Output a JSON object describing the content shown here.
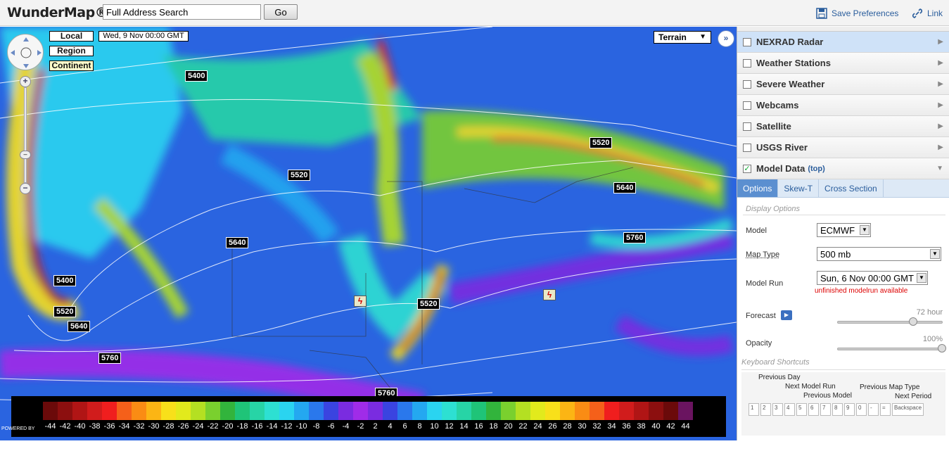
{
  "header": {
    "logo": "WunderMap®",
    "search_value": "Full Address Search",
    "go_label": "Go",
    "save_prefs": "Save Preferences",
    "link": "Link"
  },
  "map": {
    "zoom_buttons": [
      "Local",
      "Region",
      "Continent"
    ],
    "date_label": "Wed, 9 Nov 00:00 GMT",
    "basemap": "Terrain",
    "expand_icon": "double-chevron-right",
    "contour_labels": [
      {
        "text": "5400"
      },
      {
        "text": "5520"
      },
      {
        "text": "5520"
      },
      {
        "text": "5640"
      },
      {
        "text": "5640"
      },
      {
        "text": "5760"
      },
      {
        "text": "5400"
      },
      {
        "text": "5520"
      },
      {
        "text": "5640"
      },
      {
        "text": "5760"
      },
      {
        "text": "5520"
      },
      {
        "text": "5760"
      }
    ],
    "attribution": "POWERED BY"
  },
  "legend": {
    "ticks": [
      "-44",
      "-42",
      "-40",
      "-38",
      "-36",
      "-34",
      "-32",
      "-30",
      "-28",
      "-26",
      "-24",
      "-22",
      "-20",
      "-18",
      "-16",
      "-14",
      "-12",
      "-10",
      "-8",
      "-6",
      "-4",
      "-2",
      "2",
      "4",
      "6",
      "8",
      "10",
      "12",
      "14",
      "16",
      "18",
      "20",
      "22",
      "24",
      "26",
      "28",
      "30",
      "32",
      "34",
      "36",
      "38",
      "40",
      "42",
      "44"
    ],
    "colors": [
      "#c81fb4",
      "#9b1fa0",
      "#6a1460",
      "#6b0a0a",
      "#8c0f0f",
      "#b01515",
      "#d11c1c",
      "#f01e1e",
      "#f5601a",
      "#fa8c14",
      "#fcb514",
      "#f8e01a",
      "#e2ea1c",
      "#b4e022",
      "#7ad02e",
      "#32b43c",
      "#1fc478",
      "#27d4a6",
      "#2de0d2",
      "#2ad4f0",
      "#24a8f0",
      "#2a78ec",
      "#3a44e0",
      "#7a2ce0",
      "#a02ce8",
      "#7a2ce0",
      "#3a44e0",
      "#2a78ec",
      "#24a8f0",
      "#2ad4f0",
      "#2de0d2",
      "#27d4a6",
      "#1fc478",
      "#32b43c",
      "#7ad02e",
      "#b4e022",
      "#e2ea1c",
      "#f8e01a",
      "#fcb514",
      "#fa8c14",
      "#f5601a",
      "#f01e1e",
      "#d11c1c",
      "#b01515",
      "#8c0f0f",
      "#6b0a0a",
      "#6a1460",
      "#9b1fa0",
      "#c81fb4"
    ]
  },
  "panel": {
    "layers": [
      {
        "label": "NEXRAD Radar",
        "checked": false
      },
      {
        "label": "Weather Stations",
        "checked": false
      },
      {
        "label": "Severe Weather",
        "checked": false
      },
      {
        "label": "Webcams",
        "checked": false
      },
      {
        "label": "Satellite",
        "checked": false
      },
      {
        "label": "USGS River",
        "checked": false
      },
      {
        "label": "Model Data",
        "checked": true,
        "suffix": "(top)"
      }
    ],
    "tabs": [
      "Options",
      "Skew-T",
      "Cross Section"
    ],
    "display_options": "Display Options",
    "model_label": "Model",
    "model_value": "ECMWF",
    "maptype_label": "Map Type",
    "maptype_value": "500 mb",
    "modelrun_label": "Model Run",
    "modelrun_value": "Sun, 6 Nov 00:00 GMT",
    "modelrun_note": "unfinished modelrun available",
    "forecast_label": "Forecast",
    "forecast_value": "72 hour",
    "forecast_level": 0.72,
    "opacity_label": "Opacity",
    "opacity_value": "100%",
    "opacity_level": 1.0,
    "kb_title": "Keyboard Shortcuts",
    "kb_labels": [
      "Previous Day",
      "Next Model Run",
      "Previous Model",
      "Previous Map Type",
      "Next Period"
    ],
    "kb_keys": [
      "1",
      "2",
      "3",
      "4",
      "5",
      "6",
      "7",
      "8",
      "9",
      "0",
      "-",
      "=",
      "Backspace"
    ]
  }
}
